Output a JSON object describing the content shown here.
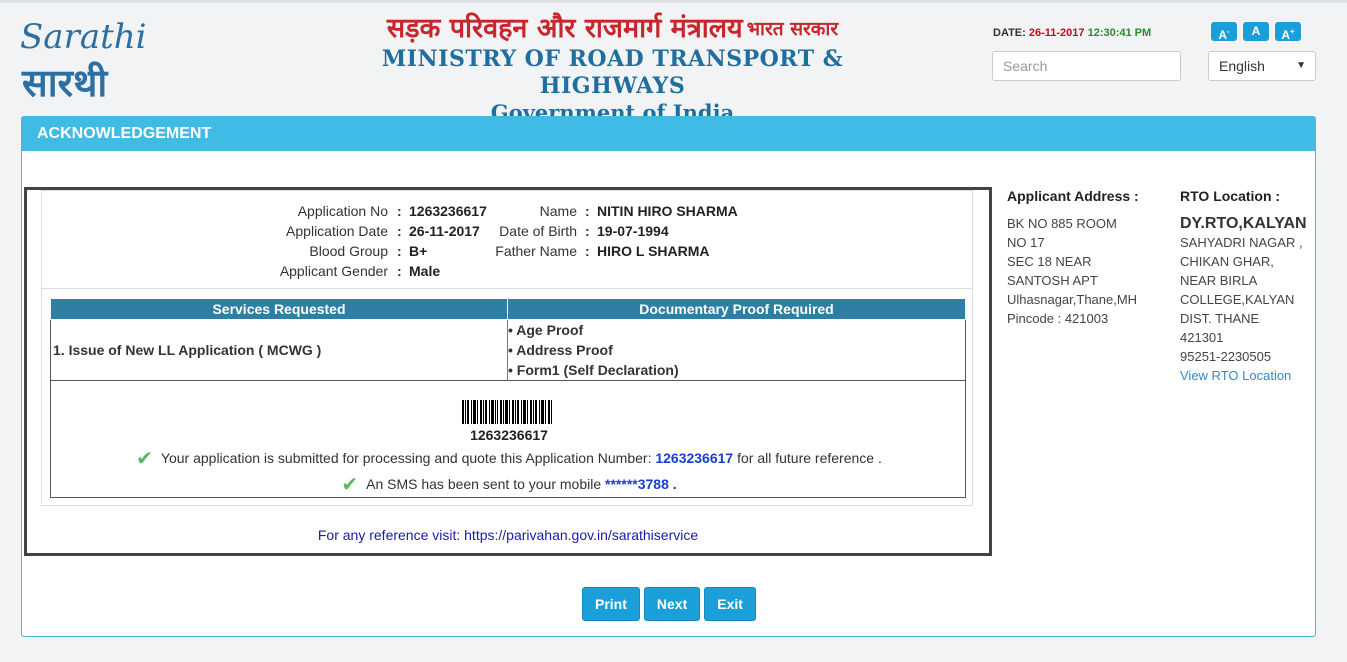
{
  "header": {
    "logo_text_latin": "Sarathi",
    "logo_text_hindi": "सारथी",
    "ministry_hindi": "सड़क परिवहन और राजमार्ग मंत्रालय",
    "ministry_hindi_small": "भारत सरकार",
    "ministry_english": "MINISTRY OF ROAD TRANSPORT & HIGHWAYS",
    "government": "Government of India",
    "date_label": "DATE:",
    "date": "26-11-2017",
    "time": "12:30:41 PM",
    "font_buttons": [
      "A-",
      "A",
      "A+"
    ],
    "search_placeholder": "Search",
    "language": "English"
  },
  "panel": {
    "title": "ACKNOWLEDGEMENT"
  },
  "applicant": {
    "app_no_label": "Application No",
    "app_no": "1263236617",
    "app_date_label": "Application Date",
    "app_date": "26-11-2017",
    "blood_group_label": "Blood Group",
    "blood_group": "B+",
    "gender_label": "Applicant Gender",
    "gender": "Male",
    "name_label": "Name",
    "name": "NITIN HIRO SHARMA",
    "dob_label": "Date of Birth",
    "dob": "19-07-1994",
    "father_label": "Father Name",
    "father": "HIRO L SHARMA"
  },
  "services": {
    "col1": "Services Requested",
    "col2": "Documentary Proof Required",
    "service": "1. Issue of New LL Application ( MCWG )",
    "proofs": [
      "• Age Proof",
      "• Address Proof",
      "• Form1 (Self Declaration)"
    ]
  },
  "submission": {
    "barcode_number": "1263236617",
    "msg1_pre": "Your application is submitted for processing and quote this Application Number:",
    "msg1_num": "1263236617",
    "msg1_post": "for all future reference .",
    "msg2_pre": "An SMS has been sent to your mobile",
    "msg2_num": "******3788",
    "msg2_post": "."
  },
  "reference": "For any reference visit: https://parivahan.gov.in/sarathiservice",
  "address": {
    "title": "Applicant Address :",
    "lines": [
      "BK NO 885 ROOM",
      "NO 17",
      "SEC 18 NEAR",
      "SANTOSH APT",
      "Ulhasnagar,Thane,MH",
      "Pincode : 421003"
    ]
  },
  "rto": {
    "title": "RTO Location :",
    "office": "DY.RTO,KALYAN",
    "lines": [
      "SAHYADRI NAGAR ,",
      "CHIKAN GHAR,",
      "NEAR BIRLA",
      "COLLEGE,KALYAN",
      "DIST. THANE",
      "421301",
      "95251-2230505"
    ],
    "link": "View RTO Location"
  },
  "actions": {
    "print": "Print",
    "next": "Next",
    "exit": "Exit"
  },
  "colors": {
    "panel_header": "#3fbbe6",
    "table_header": "#2e7fa3",
    "button": "#1a9fd8",
    "ministry_red": "#c8262c",
    "ministry_blue": "#1f6ea0"
  }
}
